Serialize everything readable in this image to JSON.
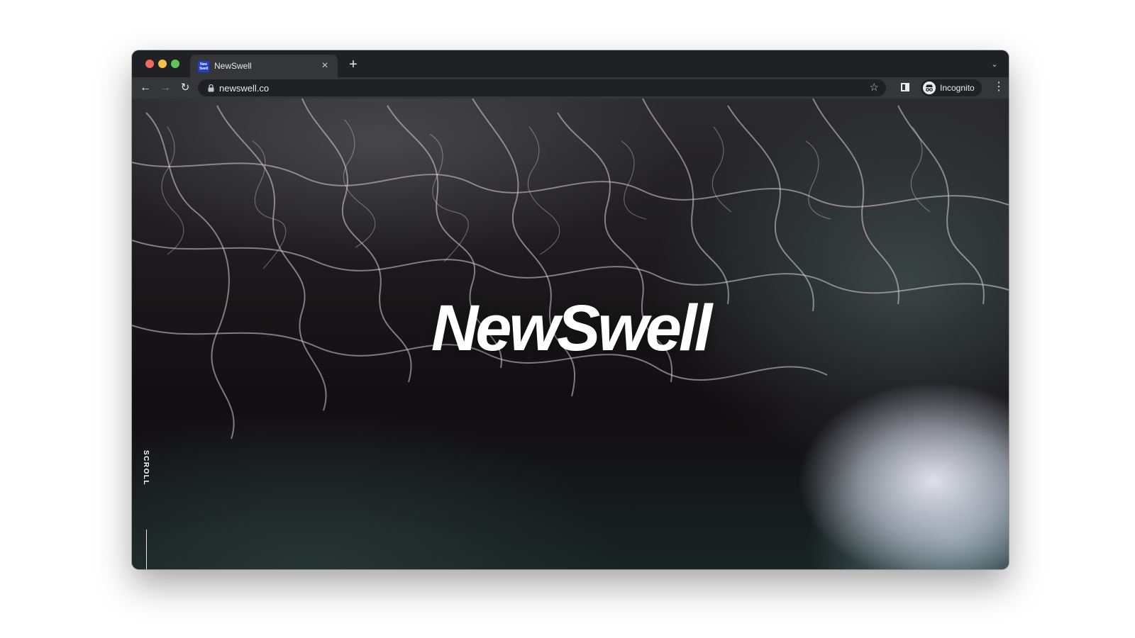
{
  "browser": {
    "tab": {
      "title": "NewSwell",
      "favicon_text": "New Swell",
      "close_glyph": "×"
    },
    "new_tab_glyph": "+",
    "tab_search_glyph": "⌄",
    "nav": {
      "back_glyph": "←",
      "forward_glyph": "→",
      "reload_glyph": "↻"
    },
    "address": {
      "url": "newswell.co",
      "lock_icon": "lock-icon"
    },
    "bookmark_glyph": "☆",
    "profile": {
      "label": "Incognito",
      "icon": "incognito-icon"
    },
    "menu_glyph": "⋮",
    "traffic_lights": {
      "close": "#ec6a5e",
      "minimize": "#f4bf4f",
      "maximize": "#61c554"
    }
  },
  "page": {
    "hero_title": "NewSwell",
    "scroll_label": "SCROLL",
    "background_description_color": "#120d10"
  }
}
